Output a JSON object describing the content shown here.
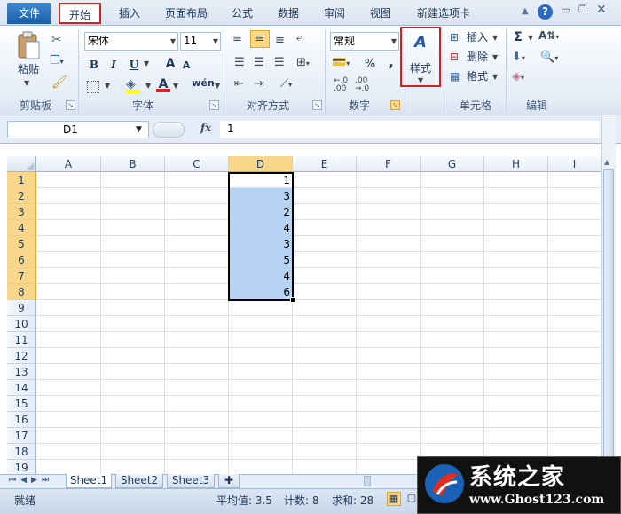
{
  "tabs": {
    "file": "文件",
    "home": "开始",
    "insert": "插入",
    "layout": "页面布局",
    "formula": "公式",
    "data": "数据",
    "review": "审阅",
    "view": "视图",
    "newtab": "新建选项卡"
  },
  "clipboard": {
    "paste": "粘贴",
    "label": "剪贴板"
  },
  "font": {
    "name": "宋体",
    "size": "11",
    "bold": "B",
    "italic": "I",
    "underline": "U",
    "grow": "A",
    "shrink": "A",
    "color_a": "A",
    "wen": "wén",
    "label": "字体"
  },
  "align": {
    "label": "对齐方式"
  },
  "number": {
    "format": "常规",
    "percent": "%",
    "comma": ",",
    "label": "数字"
  },
  "style": {
    "label": "样式"
  },
  "cells": {
    "insert": "插入",
    "delete": "删除",
    "format": "格式",
    "label": "单元格"
  },
  "edit": {
    "sum": "Σ",
    "label": "编辑"
  },
  "formula_bar": {
    "name_box": "D1",
    "fx": "fx",
    "content": "1"
  },
  "columns": [
    "A",
    "B",
    "C",
    "D",
    "E",
    "F",
    "G",
    "H",
    "I"
  ],
  "rows": [
    "1",
    "2",
    "3",
    "4",
    "5",
    "6",
    "7",
    "8",
    "9",
    "10",
    "11",
    "12",
    "13",
    "14",
    "15",
    "16",
    "17",
    "18",
    "19"
  ],
  "d_values": [
    "1",
    "3",
    "2",
    "4",
    "3",
    "5",
    "4",
    "6"
  ],
  "sheets": [
    "Sheet1",
    "Sheet2",
    "Sheet3"
  ],
  "status": {
    "ready": "就绪",
    "average": "平均值: 3.5",
    "count": "计数: 8",
    "sum": "求和: 28"
  },
  "watermark": {
    "title": "系统之家",
    "url": "www.Ghost123.com"
  },
  "colors": {
    "accent": "#1c5ea8",
    "highlight": "#d81e1e",
    "selection": "#b7d3f3"
  }
}
